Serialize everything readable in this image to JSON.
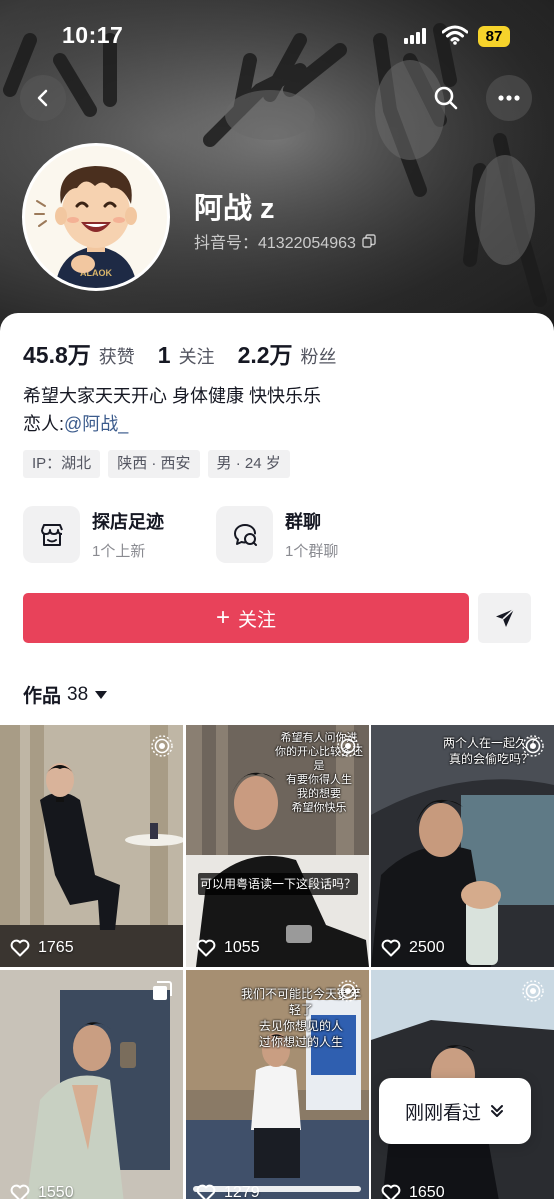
{
  "status_bar": {
    "time": "10:17",
    "battery": "87"
  },
  "profile": {
    "nickname": "阿战 z",
    "douyin_id": "抖音号：41322054963",
    "stats": [
      {
        "value": "45.8万",
        "label": "获赞"
      },
      {
        "value": "1",
        "label": "关注"
      },
      {
        "value": "2.2万",
        "label": "粉丝"
      }
    ],
    "bio_line1": "希望大家天天开心 身体健康 快快乐乐",
    "bio_line2_prefix": "恋人:",
    "bio_mention": "@阿战_",
    "tags": [
      "IP：湖北",
      "陕西 · 西安",
      "男 · 24 岁"
    ]
  },
  "features": [
    {
      "title": "探店足迹",
      "subtitle": "1个上新",
      "icon": "store-icon"
    },
    {
      "title": "群聊",
      "subtitle": "1个群聊",
      "icon": "group-chat-icon"
    }
  ],
  "actions": {
    "follow_label": "关注",
    "follow_plus": "+"
  },
  "works": {
    "tab_label": "作品",
    "count": "38"
  },
  "videos": [
    {
      "likes": "1765",
      "corner": "live-photo-icon"
    },
    {
      "likes": "1055",
      "corner": "live-photo-icon",
      "caption": "希望有人问你进\n你的开心比较多还是\n有要你得人生\n我的想要\n希望你快乐",
      "subtitle": "可以用粤语读一下这段话吗？"
    },
    {
      "likes": "2500",
      "corner": "live-photo-icon",
      "caption": "两个人在一起久了\n真的会偷吃吗？"
    },
    {
      "likes": "1550",
      "corner": "multi-image-icon"
    },
    {
      "likes": "1279",
      "corner": "live-photo-icon",
      "caption": "我们不可能比今天更年轻了\n去见你想见的人\n过你想过的人生"
    },
    {
      "likes": "1650",
      "corner": "live-photo-icon"
    }
  ],
  "recent_pill": {
    "label": "刚刚看过"
  },
  "colors": {
    "accent": "#e8425a",
    "mention": "#3b5b8c",
    "tag_bg": "#f1f1f2"
  }
}
